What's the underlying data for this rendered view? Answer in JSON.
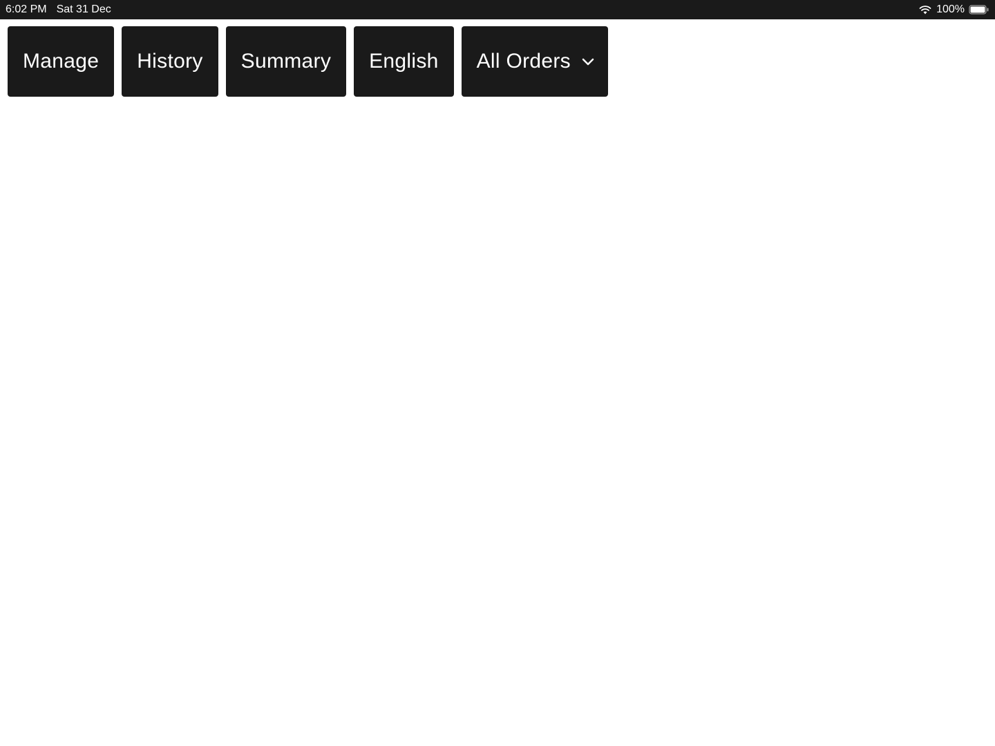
{
  "status_bar": {
    "time": "6:02 PM",
    "date": "Sat 31 Dec",
    "battery": "100%"
  },
  "toolbar": {
    "manage_label": "Manage",
    "history_label": "History",
    "summary_label": "Summary",
    "english_label": "English",
    "all_orders_label": "All Orders"
  }
}
